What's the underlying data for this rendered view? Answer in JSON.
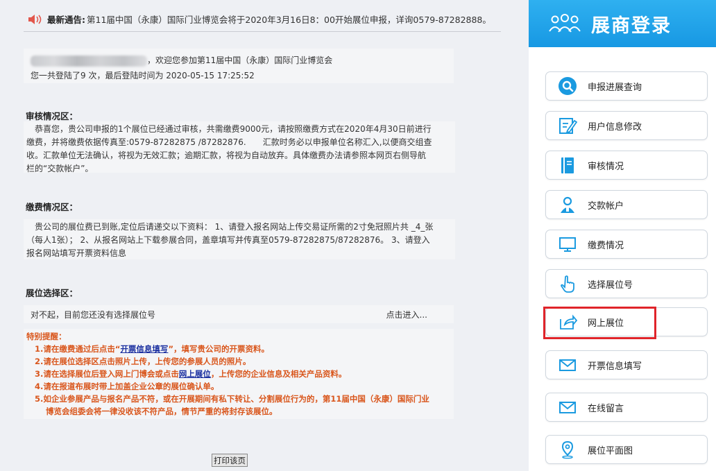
{
  "notice": {
    "label": "最新通告:",
    "text": "第11届中国（永康）国际门业博览会将于2020年3月16日8：00开始展位申报，详询0579-87282888。"
  },
  "welcome": {
    "line1": "，欢迎您参加第11届中国（永康）国际门业博览会",
    "line2": "您一共登陆了9 次，最后登陆时间为 2020-05-15 17:25:52"
  },
  "review": {
    "title": "审核情况区：",
    "lines": [
      "　恭喜您，贵公司申报的1个展位已经通过审核，共需缴费9000元，请按照缴费方式在2020年4月30日前进行",
      "缴费，并将缴费依据传真至:0579-87282875 /87282876.　　汇款时务必以申报单位名称汇入,以便商交组查",
      "收。汇款单位无法确认，将视为无效汇款；逾期汇款，将视为自动放弃。具体缴费办法请参照本网页右侧导航",
      "栏的“交款帐户”。"
    ]
  },
  "payment": {
    "title": "缴费情况区：",
    "lines": [
      "　贵公司的展位费已到账,定位后请递交以下资料： 1、请登入报名网站上传交易证所需的2寸免冠照片共 _4_张",
      "（每人1张）；  2、从报名网站上下载参展合同，盖章填写并传真至0579-87282875/87282876。 3、请登入",
      "报名网站填写开票资料信息"
    ]
  },
  "booth": {
    "title": "展位选择区：",
    "status": "对不起，目前您还没有选择展位号",
    "enter": "点击进入..."
  },
  "reminder": {
    "title": "特别提醒：",
    "item1_a": "1.请在缴费通过后点击“",
    "item1_link": "开票信息填写",
    "item1_b": "”，填写贵公司的开票资料。",
    "item2": "2.请在展位选择区点击照片上传，上传您的参展人员的照片。",
    "item3_a": "3.请在选择展位后登入网上门博会或点击",
    "item3_link": "网上展位",
    "item3_b": "，上传您的企业信息及相关产品资料。",
    "item4": "4.请在报道布展时带上加盖企业公章的展位确认单。",
    "item5_a": "5.如企业参展产品与报名产品不符，或在开展期间有私下转让、分割展位行为的，第11届中国（永康）国际门业",
    "item5_b": "博览会组委会将一律没收该不符产品，情节严重的将封存该展位。"
  },
  "print_label": "打印该页",
  "sidebar": {
    "title": "展商登录",
    "items": [
      {
        "label": "申报进展查询",
        "icon": "search-icon"
      },
      {
        "label": "用户信息修改",
        "icon": "edit-icon"
      },
      {
        "label": "审核情况",
        "icon": "notebook-icon"
      },
      {
        "label": "交款帐户",
        "icon": "user-icon"
      },
      {
        "label": "缴费情况",
        "icon": "monitor-icon"
      },
      {
        "label": "选择展位号",
        "icon": "hand-pointer-icon"
      },
      {
        "label": "网上展位",
        "icon": "share-icon"
      },
      {
        "label": "开票信息填写",
        "icon": "mail-icon"
      },
      {
        "label": "在线留言",
        "icon": "mail-icon"
      },
      {
        "label": "展位平面图",
        "icon": "location-pin-icon"
      }
    ]
  },
  "colors": {
    "accent": "#1798e3",
    "reminder": "#d9561c",
    "highlight": "#e0242a",
    "icon_blue": "#1a9ae0"
  }
}
